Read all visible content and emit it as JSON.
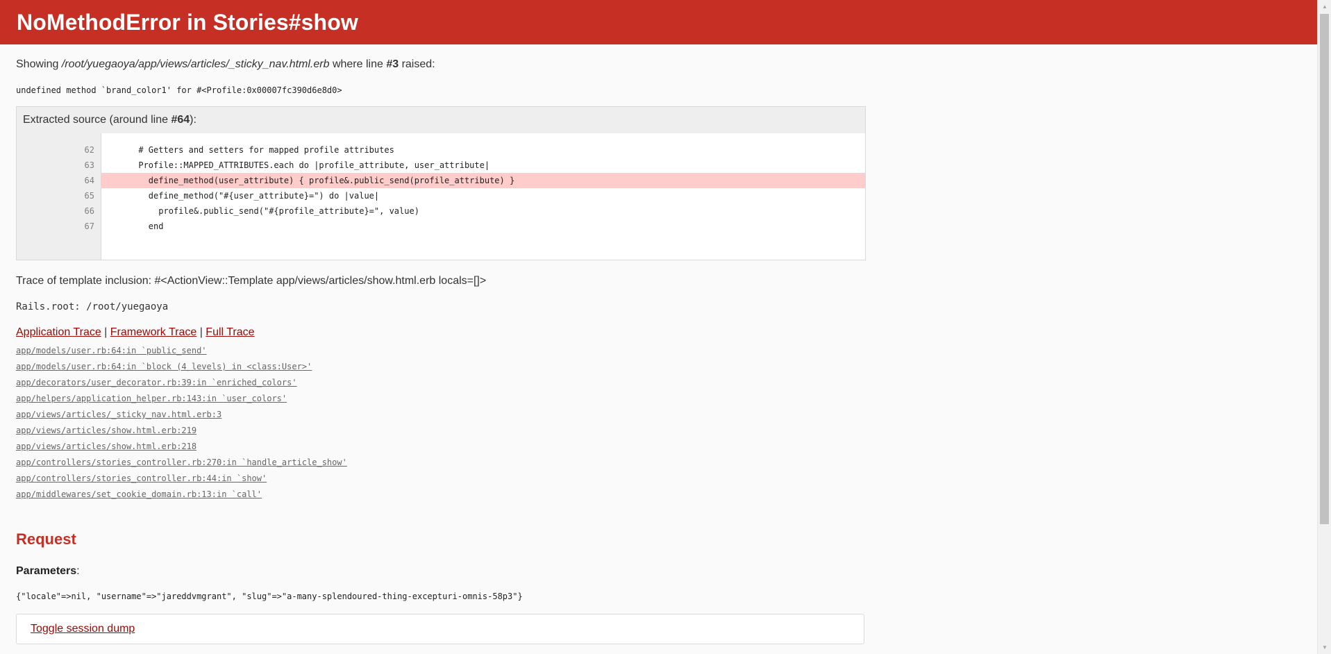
{
  "header": {
    "title": "NoMethodError in Stories#show"
  },
  "showing": {
    "prefix": "Showing ",
    "path": "/root/yuegaoya/app/views/articles/_sticky_nav.html.erb",
    "middle": " where line ",
    "line": "#3",
    "suffix": " raised:"
  },
  "error_message": "undefined method `brand_color1' for #<Profile:0x00007fc390d6e8d0>",
  "source": {
    "info_prefix": "Extracted source (around line ",
    "info_line": "#64",
    "info_suffix": "):",
    "line_numbers": [
      "62",
      "63",
      "64",
      "65",
      "66",
      "67"
    ],
    "code_lines": [
      "      # Getters and setters for mapped profile attributes",
      "      Profile::MAPPED_ATTRIBUTES.each do |profile_attribute, user_attribute|",
      "        define_method(user_attribute) { profile&.public_send(profile_attribute) }",
      "        define_method(\"#{user_attribute}=\") do |value|",
      "          profile&.public_send(\"#{profile_attribute}=\", value)",
      "        end"
    ]
  },
  "template_trace": "Trace of template inclusion: #<ActionView::Template app/views/articles/show.html.erb locals=[]>",
  "rails_root": "Rails.root: /root/yuegaoya",
  "trace_tabs": {
    "application": "Application Trace",
    "separator": " | ",
    "framework": "Framework Trace",
    "full": "Full Trace"
  },
  "trace_lines": [
    "app/models/user.rb:64:in `public_send'",
    "app/models/user.rb:64:in `block (4 levels) in <class:User>'",
    "app/decorators/user_decorator.rb:39:in `enriched_colors'",
    "app/helpers/application_helper.rb:143:in `user_colors'",
    "app/views/articles/_sticky_nav.html.erb:3",
    "app/views/articles/show.html.erb:219",
    "app/views/articles/show.html.erb:218",
    "app/controllers/stories_controller.rb:270:in `handle_article_show'",
    "app/controllers/stories_controller.rb:44:in `show'",
    "app/middlewares/set_cookie_domain.rb:13:in `call'"
  ],
  "request": {
    "heading": "Request",
    "params_label": "Parameters",
    "params_colon": ":",
    "params_value": "{\"locale\"=>nil, \"username\"=>\"jareddvmgrant\", \"slug\"=>\"a-many-splendoured-thing-excepturi-omnis-58p3\"}",
    "toggle_session": "Toggle session dump"
  },
  "colors": {
    "header_bg": "#C52F24",
    "link": "#980905",
    "error_line_bg": "#ffcccc"
  }
}
